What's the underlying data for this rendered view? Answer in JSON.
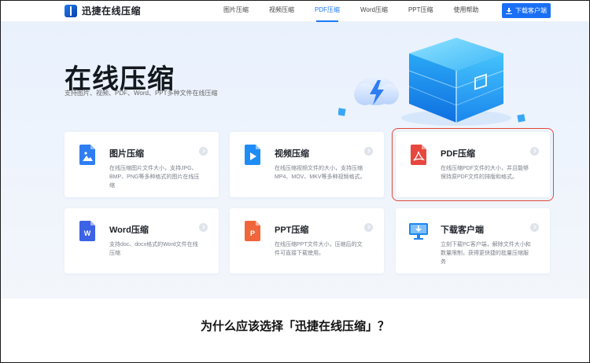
{
  "header": {
    "logo_text": "迅捷在线压缩",
    "nav": [
      "图片压缩",
      "视频压缩",
      "PDF压缩",
      "Word压缩",
      "PPT压缩",
      "使用帮助"
    ],
    "active_nav": "PDF压缩",
    "download_button": "下载客户端"
  },
  "hero": {
    "title": "在线压缩",
    "subtitle": "支持图片、视频、PDF、Word、PPT多种文件在线压缩"
  },
  "cards": [
    {
      "title": "图片压缩",
      "desc": "在线压缩图片文件大小，支持JPG、BMP、PNG等多种格式的图片在线压缩",
      "icon": "image-file-icon",
      "color": "#2f7df3"
    },
    {
      "title": "视频压缩",
      "desc": "在线压缩视频文件的大小，支持压缩MP4、MOV、MKV等多种视频格式。",
      "icon": "video-file-icon",
      "color": "#1e8cf5"
    },
    {
      "title": "PDF压缩",
      "desc": "在线压缩PDF文件的大小，并且能够保持原PDF文件的排版和格式。",
      "icon": "pdf-file-icon",
      "color": "#e8473f"
    },
    {
      "title": "Word压缩",
      "desc": "支持doc、docx格式的Word文件在线压缩",
      "icon": "word-file-icon",
      "color": "#3c62e6"
    },
    {
      "title": "PPT压缩",
      "desc": "在线压缩PPT文件大小，压缩后的文件可直接下载使用。",
      "icon": "ppt-file-icon",
      "color": "#f0663a"
    },
    {
      "title": "下载客户端",
      "desc": "立刻下载PC客户端，解除文件大小和数量限制，获得更快捷的批量压缩服务",
      "icon": "desktop-download-icon",
      "color": "#1f86f0"
    }
  ],
  "bottom_heading": "为什么应该选择「迅捷在线压缩」？"
}
